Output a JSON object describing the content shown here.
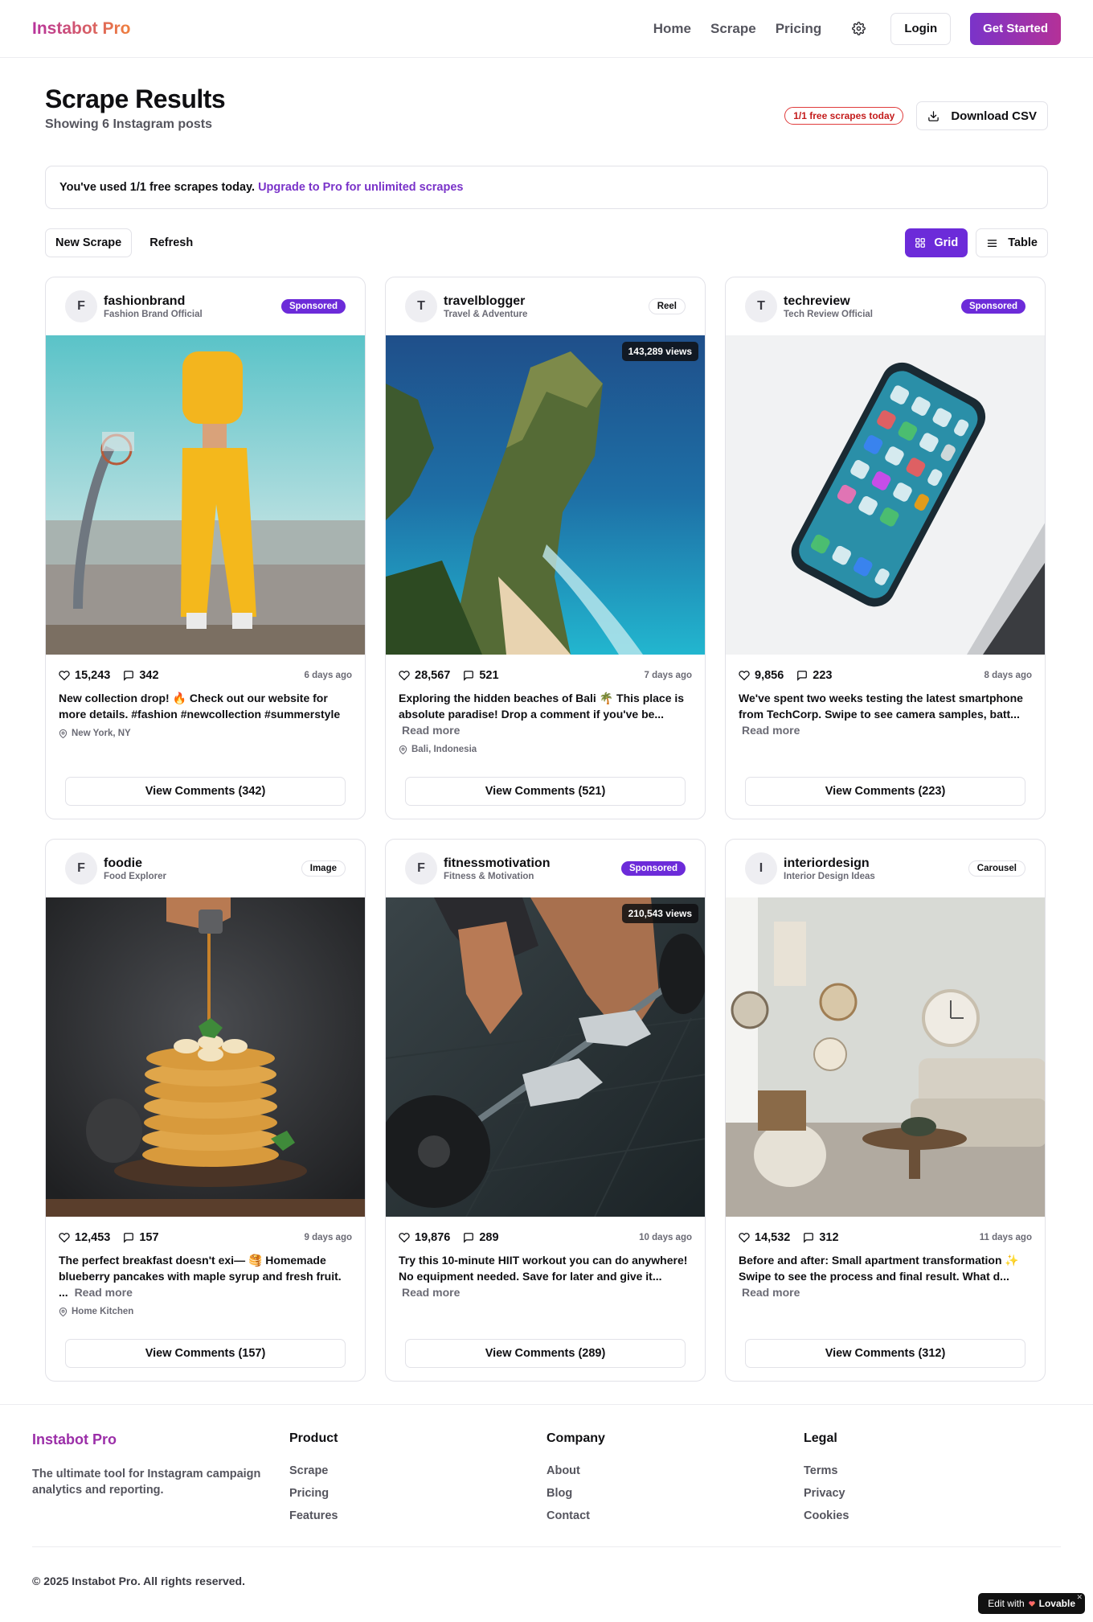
{
  "nav": {
    "brand": "Instabot Pro",
    "links": [
      "Home",
      "Scrape",
      "Pricing"
    ],
    "login": "Login",
    "get_started": "Get Started"
  },
  "page": {
    "title": "Scrape Results",
    "subtitle": "Showing 6 Instagram posts",
    "scrape_badge": "1/1 free scrapes today",
    "download_csv": "Download CSV"
  },
  "notice": {
    "text": "You've used 1/1 free scrapes today.",
    "link": "Upgrade to Pro for unlimited scrapes"
  },
  "toolbar": {
    "new_scrape": "New Scrape",
    "refresh": "Refresh",
    "grid": "Grid",
    "table": "Table"
  },
  "posts": [
    {
      "initial": "F",
      "username": "fashionbrand",
      "fullname": "Fashion Brand Official",
      "type": "Sponsored",
      "views": "",
      "likes": "15,243",
      "comments": "342",
      "age": "6 days ago",
      "caption": "New collection drop! 🔥 Check out our website for more details. #fashion #newcollection #summerstyle",
      "read_more": "",
      "location": "New York, NY",
      "comments_button": "View Comments (342)"
    },
    {
      "initial": "T",
      "username": "travelblogger",
      "fullname": "Travel & Adventure",
      "type": "Reel",
      "views": "143,289 views",
      "likes": "28,567",
      "comments": "521",
      "age": "7 days ago",
      "caption": "Exploring the hidden beaches of Bali 🌴 This place is absolute paradise! Drop a comment if you've be...",
      "read_more": "Read more",
      "location": "Bali, Indonesia",
      "comments_button": "View Comments (521)"
    },
    {
      "initial": "T",
      "username": "techreview",
      "fullname": "Tech Review Official",
      "type": "Sponsored",
      "views": "",
      "likes": "9,856",
      "comments": "223",
      "age": "8 days ago",
      "caption": "We've spent two weeks testing the latest smartphone from TechCorp. Swipe to see camera samples, batt...",
      "read_more": "Read more",
      "location": "",
      "comments_button": "View Comments (223)"
    },
    {
      "initial": "F",
      "username": "foodie",
      "fullname": "Food Explorer",
      "type": "Image",
      "views": "",
      "likes": "12,453",
      "comments": "157",
      "age": "9 days ago",
      "caption": "The perfect breakfast doesn't exi— 🥞 Homemade blueberry pancakes with maple syrup and fresh fruit. ...",
      "read_more": "Read more",
      "location": "Home Kitchen",
      "comments_button": "View Comments (157)"
    },
    {
      "initial": "F",
      "username": "fitnessmotivation",
      "fullname": "Fitness & Motivation",
      "type": "Sponsored",
      "views": "210,543 views",
      "likes": "19,876",
      "comments": "289",
      "age": "10 days ago",
      "caption": "Try this 10-minute HIIT workout you can do anywhere! No equipment needed. Save for later and give it...",
      "read_more": "Read more",
      "location": "",
      "comments_button": "View Comments (289)"
    },
    {
      "initial": "I",
      "username": "interiordesign",
      "fullname": "Interior Design Ideas",
      "type": "Carousel",
      "views": "",
      "likes": "14,532",
      "comments": "312",
      "age": "11 days ago",
      "caption": "Before and after: Small apartment transformation ✨ Swipe to see the process and final result. What d...",
      "read_more": "Read more",
      "location": "",
      "comments_button": "View Comments (312)"
    }
  ],
  "footer": {
    "brand": "Instabot Pro",
    "tagline": "The ultimate tool for Instagram campaign analytics and reporting.",
    "product": {
      "heading": "Product",
      "links": [
        "Scrape",
        "Pricing",
        "Features"
      ]
    },
    "company": {
      "heading": "Company",
      "links": [
        "About",
        "Blog",
        "Contact"
      ]
    },
    "legal": {
      "heading": "Legal",
      "links": [
        "Terms",
        "Privacy",
        "Cookies"
      ]
    },
    "copyright": "© 2025 Instabot Pro. All rights reserved."
  },
  "lovable": {
    "prefix": "Edit with",
    "name": "Lovable"
  },
  "colors": {
    "accent": "#6c2bd9",
    "brand_gradient_start": "#b7329c",
    "brand_gradient_end": "#f0803c",
    "badge_red": "#c41c1c"
  },
  "icons": [
    "gear-icon",
    "download-icon",
    "grid-icon",
    "list-icon",
    "heart-icon",
    "comment-icon",
    "map-pin-icon",
    "lovable-heart-icon",
    "close-icon"
  ]
}
